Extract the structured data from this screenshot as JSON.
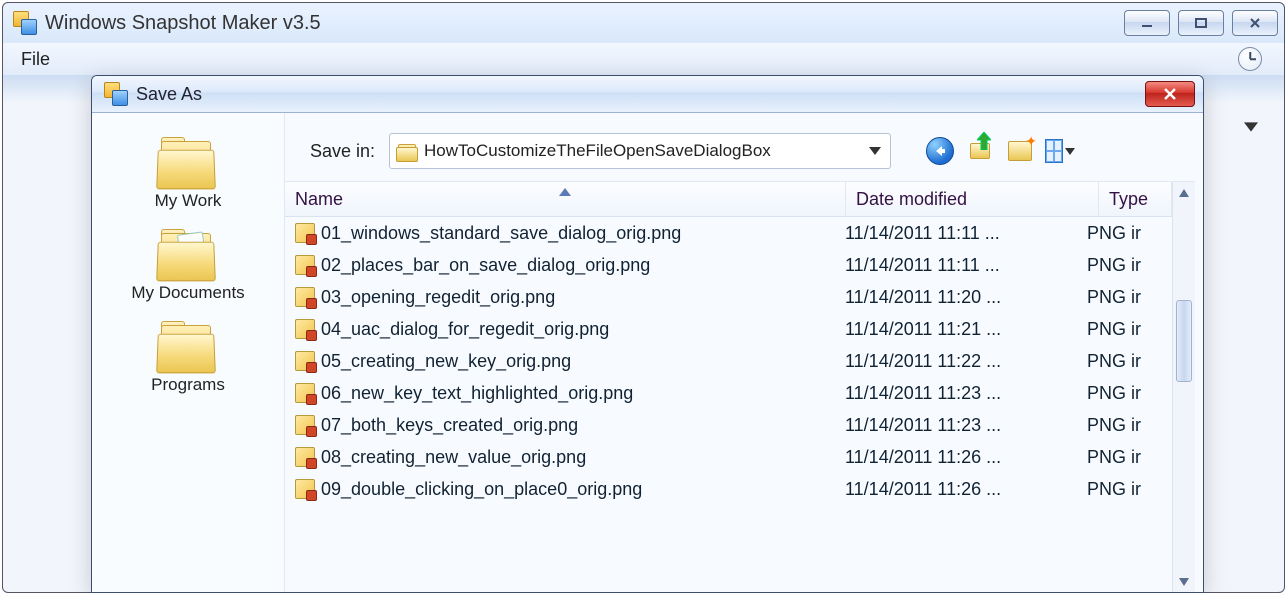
{
  "main": {
    "title": "Windows Snapshot Maker v3.5",
    "menu_file": "File"
  },
  "dialog": {
    "title": "Save As",
    "save_in_label": "Save in:",
    "save_in_value": "HowToCustomizeTheFileOpenSaveDialogBox",
    "places": [
      {
        "label": "My Work",
        "doc": false
      },
      {
        "label": "My Documents",
        "doc": true
      },
      {
        "label": "Programs",
        "doc": false
      }
    ],
    "columns": {
      "name": "Name",
      "date": "Date modified",
      "type": "Type"
    },
    "files": [
      {
        "name": "01_windows_standard_save_dialog_orig.png",
        "date": "11/14/2011 11:11 ...",
        "type": "PNG ir"
      },
      {
        "name": "02_places_bar_on_save_dialog_orig.png",
        "date": "11/14/2011 11:11 ...",
        "type": "PNG ir"
      },
      {
        "name": "03_opening_regedit_orig.png",
        "date": "11/14/2011 11:20 ...",
        "type": "PNG ir"
      },
      {
        "name": "04_uac_dialog_for_regedit_orig.png",
        "date": "11/14/2011 11:21 ...",
        "type": "PNG ir"
      },
      {
        "name": "05_creating_new_key_orig.png",
        "date": "11/14/2011 11:22 ...",
        "type": "PNG ir"
      },
      {
        "name": "06_new_key_text_highlighted_orig.png",
        "date": "11/14/2011 11:23 ...",
        "type": "PNG ir"
      },
      {
        "name": "07_both_keys_created_orig.png",
        "date": "11/14/2011 11:23 ...",
        "type": "PNG ir"
      },
      {
        "name": "08_creating_new_value_orig.png",
        "date": "11/14/2011 11:26 ...",
        "type": "PNG ir"
      },
      {
        "name": "09_double_clicking_on_place0_orig.png",
        "date": "11/14/2011 11:26 ...",
        "type": "PNG ir"
      }
    ]
  }
}
